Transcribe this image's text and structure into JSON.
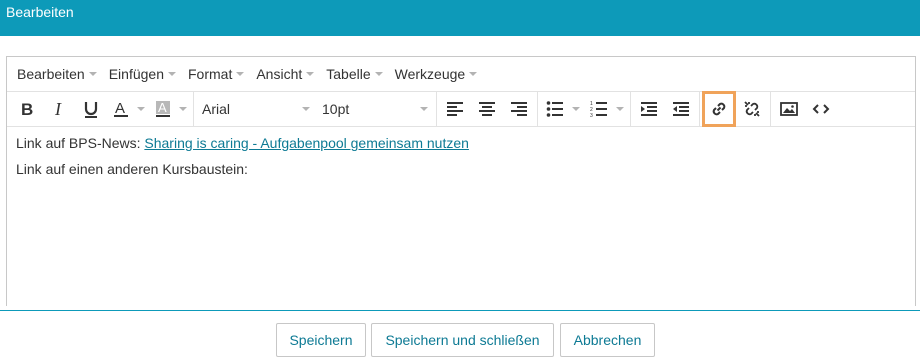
{
  "dialog": {
    "title": "Bearbeiten"
  },
  "menubar": [
    "Bearbeiten",
    "Einfügen",
    "Format",
    "Ansicht",
    "Tabelle",
    "Werkzeuge"
  ],
  "toolbar": {
    "font_family": "Arial",
    "font_size": "10pt",
    "icons": [
      "bold-icon",
      "italic-icon",
      "underline-icon",
      "text-color-icon",
      "background-color-icon",
      "align-left-icon",
      "align-center-icon",
      "align-right-icon",
      "bullet-list-icon",
      "numbered-list-icon",
      "indent-icon",
      "outdent-icon",
      "link-icon",
      "unlink-icon",
      "image-icon",
      "source-code-icon"
    ],
    "highlight_color": "#f0a35a"
  },
  "content": {
    "line1_prefix": "Link auf BPS-News: ",
    "line1_link": "Sharing is caring - Aufgabenpool gemeinsam nutzen",
    "line2": "Link auf einen anderen Kursbaustein:"
  },
  "footer": {
    "save": "Speichern",
    "save_close": "Speichern und schließen",
    "cancel": "Abbrechen"
  },
  "colors": {
    "header": "#0d9ab9",
    "link": "#0d7a94"
  }
}
